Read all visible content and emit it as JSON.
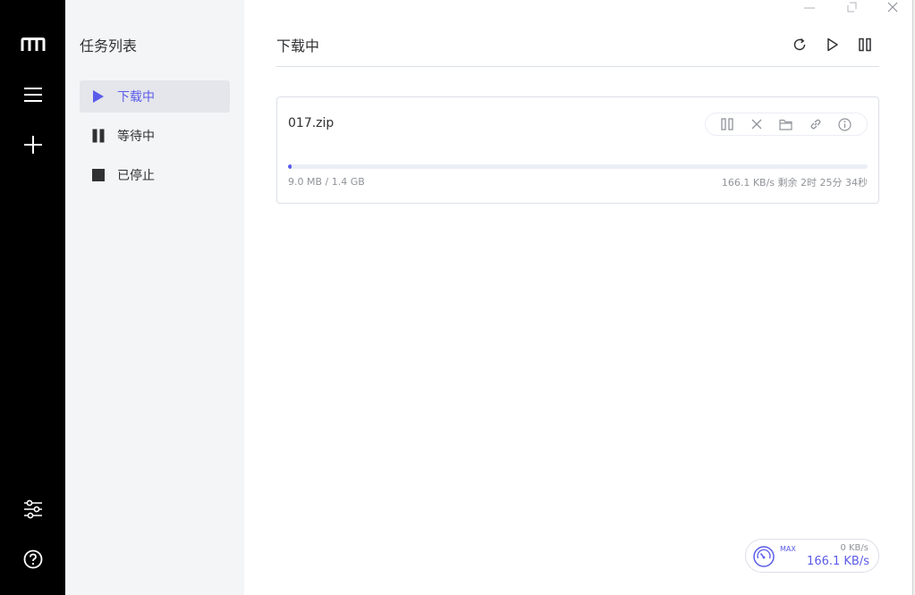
{
  "app": {
    "accent_color": "#5b5bea",
    "rail_color": "#000000"
  },
  "rail": {
    "logo_icon": "logo-m-icon",
    "menu_icon": "menu-icon",
    "add_icon": "plus-icon",
    "settings_icon": "sliders-icon",
    "help_icon": "help-circle-icon"
  },
  "sidebar": {
    "title": "任务列表",
    "items": [
      {
        "label": "下载中",
        "icon": "play-icon",
        "active": true
      },
      {
        "label": "等待中",
        "icon": "pause-icon",
        "active": false
      },
      {
        "label": "已停止",
        "icon": "stop-icon",
        "active": false
      }
    ]
  },
  "header": {
    "title": "下载中",
    "actions": [
      "refresh-icon",
      "play-icon",
      "pause-icon"
    ]
  },
  "tasks": [
    {
      "name": "017.zip",
      "progress_fraction": 0.0064,
      "size_text": "9.0 MB / 1.4 GB",
      "speed_text": "166.1 KB/s 剩余 2时 25分 34秒",
      "actions": [
        "pause-icon",
        "delete-icon",
        "folder-icon",
        "link-icon",
        "info-icon"
      ]
    }
  ],
  "speedometer": {
    "mode": "MAX",
    "upload": "0 KB/s",
    "download": "166.1 KB/s"
  }
}
